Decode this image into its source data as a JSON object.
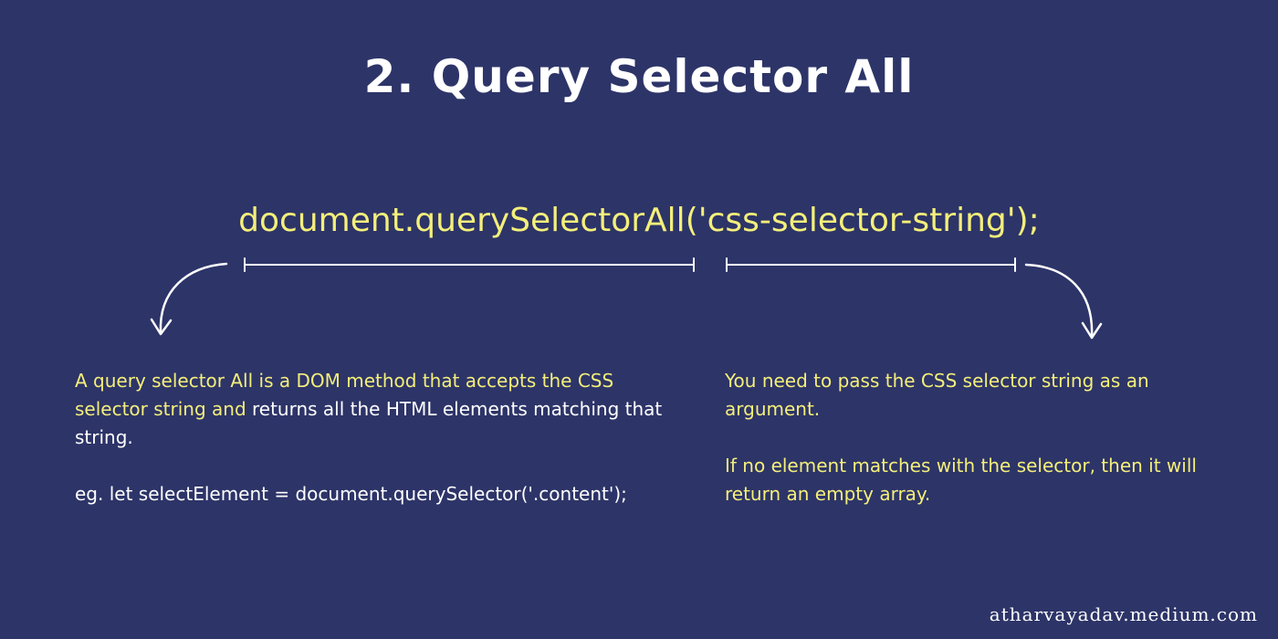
{
  "title": "2. Query Selector All",
  "code": "document.querySelectorAll('css-selector-string');",
  "left_description": {
    "highlight_part": "A query selector All is a DOM method that accepts the CSS selector string and",
    "plain_part": " returns all the HTML elements matching that string.",
    "example": "eg. let selectElement = document.querySelector('.content');"
  },
  "right_description": {
    "paragraph_1": "You need to pass the CSS selector string as an argument.",
    "paragraph_2": "If no element matches with the selector, then it will return an empty array."
  },
  "watermark": "atharvayadav.medium.com",
  "colors": {
    "background": "#2d3468",
    "highlight": "#f4ef7a",
    "text": "#ffffff"
  }
}
